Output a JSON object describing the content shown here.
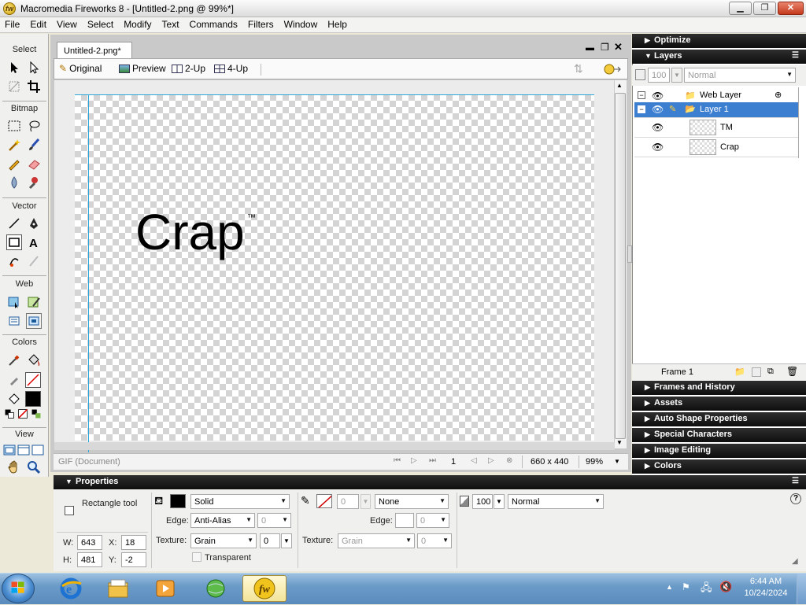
{
  "window": {
    "title": "Macromedia Fireworks 8 - [Untitled-2.png @ 99%*]",
    "minimize": "▁",
    "restore": "❐",
    "close": "✕"
  },
  "menu": [
    "File",
    "Edit",
    "View",
    "Select",
    "Modify",
    "Text",
    "Commands",
    "Filters",
    "Window",
    "Help"
  ],
  "tools": {
    "sections": [
      "Select",
      "Bitmap",
      "Vector",
      "Web",
      "Colors",
      "View"
    ]
  },
  "document": {
    "tab": "Untitled-2.png*",
    "views": [
      "Original",
      "Preview",
      "2-Up",
      "4-Up"
    ],
    "canvas_text": "Crap",
    "canvas_tm": "™",
    "status_format": "GIF (Document)",
    "frame": "1",
    "size": "660 x 440",
    "zoom": "99%"
  },
  "panels": {
    "optimize": "Optimize",
    "layers": "Layers",
    "opacity": "100",
    "blend": "Normal",
    "layer_rows": [
      {
        "name": "Web Layer",
        "type": "folder"
      },
      {
        "name": "Layer 1",
        "type": "folder",
        "selected": true
      },
      {
        "name": "TM",
        "type": "object"
      },
      {
        "name": "Crap",
        "type": "object"
      }
    ],
    "frame_label": "Frame 1",
    "collapsed": [
      "Frames and History",
      "Assets",
      "Auto Shape Properties",
      "Special Characters",
      "Image Editing",
      "Colors"
    ]
  },
  "properties": {
    "title": "Properties",
    "tool_name": "Rectangle tool",
    "w_label": "W:",
    "w": "643",
    "h_label": "H:",
    "h": "481",
    "x_label": "X:",
    "x": "18",
    "y_label": "Y:",
    "y": "-2",
    "fill_type": "Solid",
    "edge_label": "Edge:",
    "edge": "Anti-Alias",
    "edge_val": "0",
    "texture_label": "Texture:",
    "texture": "Grain",
    "texture_val": "0",
    "transparent": "Transparent",
    "stroke_size": "0",
    "stroke_type": "None",
    "stroke_edge_label": "Edge:",
    "stroke_edge_val": "0",
    "stroke_texture_label": "Texture:",
    "stroke_texture": "Grain",
    "stroke_texture_val": "0",
    "opacity": "100",
    "blend": "Normal",
    "fill_color": "#000000",
    "stroke_color": "#cc0000"
  },
  "taskbar": {
    "time": "6:44 AM",
    "date": "10/24/2024"
  },
  "colors": {
    "accent": "#3c7fd1",
    "panel_dark": "#111111",
    "guide": "#2ba5d8"
  }
}
